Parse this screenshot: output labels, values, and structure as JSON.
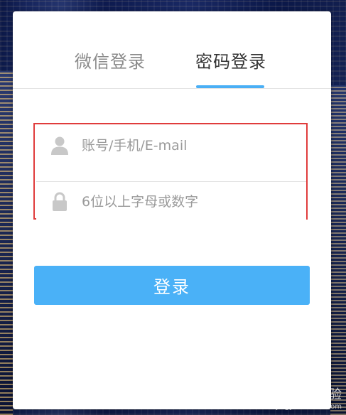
{
  "tabs": [
    {
      "label": "微信登录",
      "active": false
    },
    {
      "label": "密码登录",
      "active": true
    }
  ],
  "form": {
    "account_placeholder": "账号/手机/E-mail",
    "password_placeholder": "6位以上字母或数字",
    "account_value": "",
    "password_value": "",
    "submit_label": "登录"
  },
  "icons": {
    "account": "user-icon",
    "password": "lock-icon"
  },
  "colors": {
    "accent": "#4aaff5",
    "button": "#4ab1f7",
    "highlight_border": "#e03c3c",
    "inactive_tab": "#8a8a8a",
    "active_tab": "#333333"
  },
  "watermark": {
    "brand": "Bai 经验",
    "url": "jingyan.baidu.com"
  }
}
